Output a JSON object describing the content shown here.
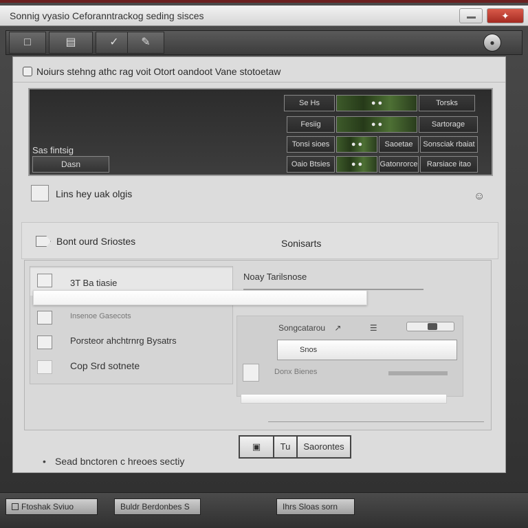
{
  "window": {
    "title": "Sonnig vyasio Ceforanntrackog seding sisces",
    "close_glyph": "✦"
  },
  "toolbar": {
    "buttons": [
      "□",
      "▤",
      "✓"
    ],
    "round_button": "●"
  },
  "panel": {
    "header": "Noiurs stehng athc rag voit Otort oandoot Vane stotoetaw"
  },
  "dark_area": {
    "label": "Sas fintsig",
    "open_button": "Dasn",
    "rows": [
      [
        "Se Hs",
        "● ●",
        "Torsks"
      ],
      [
        "Fesiig",
        "● ●",
        "Sartorage"
      ],
      [
        "Tonsi sioes",
        "● ●",
        "Saoetae",
        "Sonsciak rbaiat"
      ],
      [
        "Oaio Btsies",
        "● ●",
        "Gatonrorce",
        "Rarsiace itao"
      ]
    ]
  },
  "hint": {
    "text": "Lins hey uak olgis",
    "right_icon": "☺"
  },
  "section2": {
    "left": "Bont ourd Sriostes",
    "right": "Sonisarts"
  },
  "list": {
    "items": [
      "3T Ba tiasie",
      "Insenoe Gasecots",
      "Porsteor ahchtrnrg Bysatrs",
      "Cop Srd sotnete"
    ]
  },
  "right_box": {
    "title": "Noay Tarilsnose",
    "row1": "Songcatarou",
    "row1_arrow": "↗",
    "row1_icon": "☰",
    "input_value": "Snos",
    "row3": "Donx Bienes"
  },
  "footer": {
    "text": "Sead bnctoren c hreoes sectiy",
    "bullet": "•"
  },
  "buttons": {
    "b1": "▣",
    "b2": "Tu",
    "b3": "Saorontes"
  },
  "statusbar": {
    "items": [
      "Ftoshak Sviuo",
      "Buldr Berdonbes S",
      "Ihrs Sloas sorn"
    ]
  }
}
